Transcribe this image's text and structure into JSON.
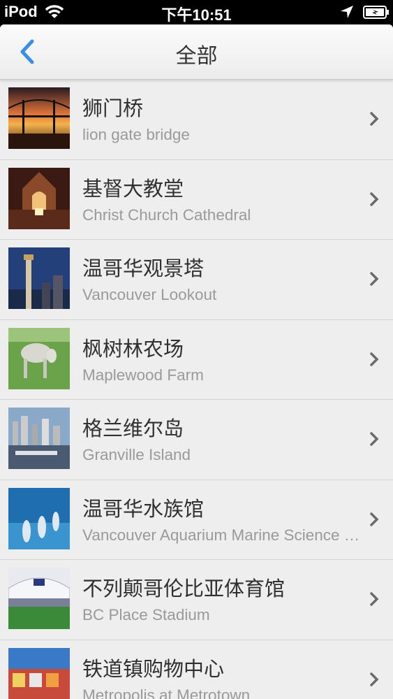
{
  "status_bar": {
    "carrier": "iPod",
    "time": "下午10:51"
  },
  "nav": {
    "title": "全部",
    "back_icon": "chevron-left-icon",
    "accent_color": "#3b8ee6"
  },
  "places": [
    {
      "title": "狮门桥",
      "subtitle": "lion gate bridge",
      "thumb_icon": "bridge-photo"
    },
    {
      "title": "基督大教堂",
      "subtitle": "Christ Church Cathedral",
      "thumb_icon": "cathedral-photo"
    },
    {
      "title": "温哥华观景塔",
      "subtitle": "Vancouver Lookout",
      "thumb_icon": "tower-photo"
    },
    {
      "title": "枫树林农场",
      "subtitle": "Maplewood Farm",
      "thumb_icon": "farm-photo"
    },
    {
      "title": "格兰维尔岛",
      "subtitle": "Granville Island",
      "thumb_icon": "island-photo"
    },
    {
      "title": "温哥华水族馆",
      "subtitle": "Vancouver Aquarium Marine Science Centre",
      "thumb_icon": "aquarium-photo"
    },
    {
      "title": "不列颠哥伦比亚体育馆",
      "subtitle": "BC Place Stadium",
      "thumb_icon": "stadium-photo"
    },
    {
      "title": "铁道镇购物中心",
      "subtitle": "Metropolis at Metrotown",
      "thumb_icon": "mall-photo"
    }
  ]
}
